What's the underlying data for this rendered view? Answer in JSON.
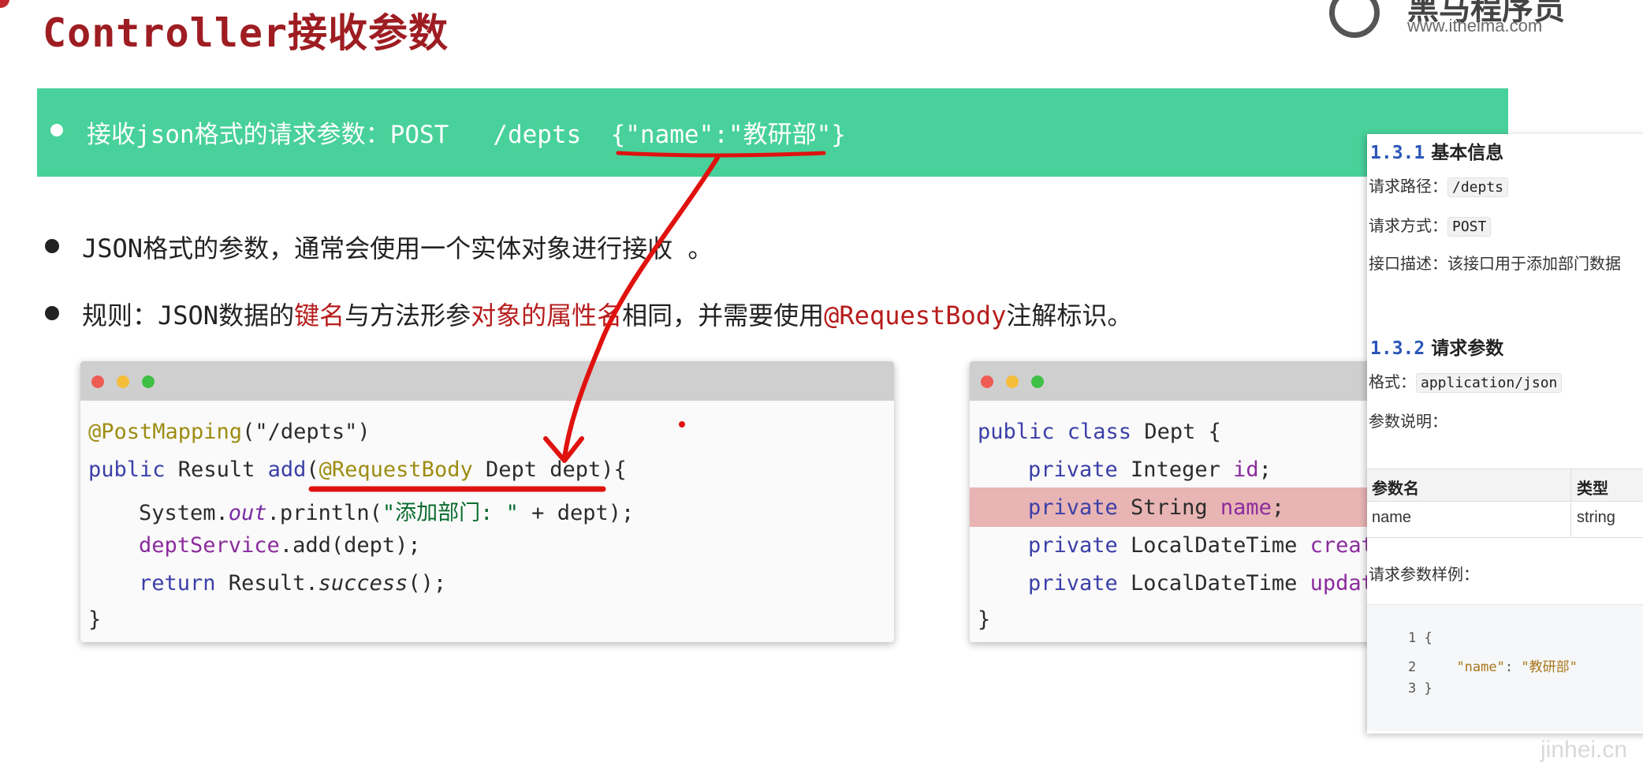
{
  "header": {
    "title": "Controller接收参数",
    "logo_name": "黑马程序员",
    "logo_url": "www.itheima.com"
  },
  "banner": {
    "text": "接收json格式的请求参数：POST   /depts  {\"name\":\"教研部\"}"
  },
  "bullets": {
    "b1": "JSON格式的参数，通常会使用一个实体对象进行接收 。",
    "b2_a": "规则：JSON数据的",
    "b2_b": "键名",
    "b2_c": "与方法形参",
    "b2_d": "对象的属性名",
    "b2_e": "相同，并需要使用",
    "b2_f": "@RequestBody",
    "b2_g": "注解标识。"
  },
  "controller_code": {
    "l1_ann": "@PostMapping",
    "l1_rest": "(\"/depts\")",
    "l2_kw": "public",
    "l2_a": " Result ",
    "l2_m": "add",
    "l2_b": "(",
    "l2_ann": "@RequestBody",
    "l2_c": " Dept dept){",
    "l3_a": "System.",
    "l3_out": "out",
    "l3_b": ".println(",
    "l3_str": "\"添加部门: \"",
    "l3_c": " + dept);",
    "l4_fld": "deptService",
    "l4_a": ".add(dept);",
    "l5_kw": "return",
    "l5_a": " Result.",
    "l5_it": "success",
    "l5_b": "();",
    "l6": "}"
  },
  "dept_code": {
    "l1_kw": "public class",
    "l1_a": " Dept {",
    "l2_kw": "private",
    "l2_a": " Integer ",
    "l2_f": "id",
    "l2_b": ";",
    "l3_kw": "private",
    "l3_a": " String ",
    "l3_f": "name",
    "l3_b": ";",
    "l4_kw": "private",
    "l4_a": " LocalDateTime ",
    "l4_f": "creat",
    "l5_kw": "private",
    "l5_a": " LocalDateTime ",
    "l5_f": "updat",
    "l6": "}"
  },
  "doc": {
    "s1_num": "1.3.1",
    "s1_title": " 基本信息",
    "path_label": "请求路径：",
    "path_value": "/depts",
    "method_label": "请求方式：",
    "method_value": "POST",
    "desc": "接口描述：该接口用于添加部门数据",
    "s2_num": "1.3.2",
    "s2_title": " 请求参数",
    "format_label": "格式：",
    "format_value": "application/json",
    "params_label": "参数说明：",
    "table_headers": [
      "参数名",
      "类型"
    ],
    "table_row": [
      "name",
      "string"
    ],
    "sample_label": "请求参数样例：",
    "sample_lines": [
      {
        "no": "1",
        "text": "{"
      },
      {
        "no": "2",
        "key": "\"name\"",
        "sep": ": ",
        "val": "\"教研部\""
      },
      {
        "no": "3",
        "text": "}"
      }
    ]
  },
  "watermark": "jinhei.cn",
  "colors": {
    "title": "#9e1d22",
    "banner": "#48d19a",
    "highlight": "#b71c1c",
    "annotation_stroke": "#e0120f",
    "row_highlight": "#e8b4b4"
  }
}
